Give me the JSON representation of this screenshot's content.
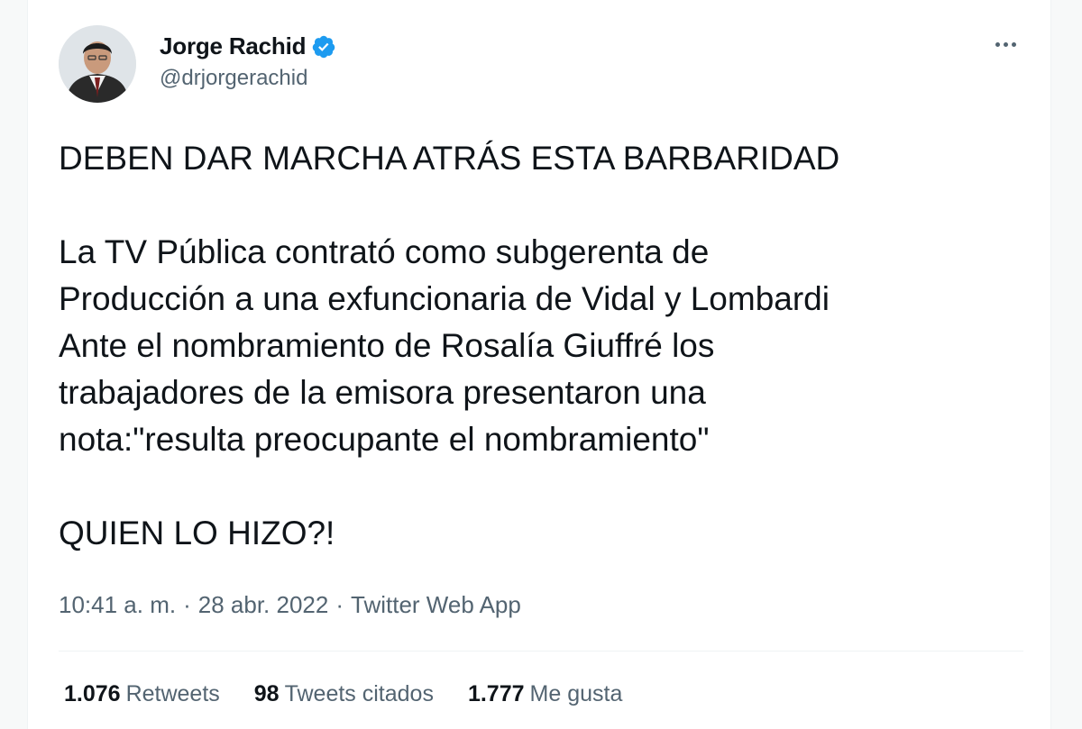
{
  "author": {
    "name": "Jorge Rachid",
    "handle": "@drjorgerachid",
    "verified": true,
    "avatar_icon": "profile-photo"
  },
  "tweet": {
    "lines": [
      "DEBEN DAR MARCHA ATRÁS ESTA BARBARIDAD",
      "",
      "La TV Pública contrató como subgerenta de",
      "Producción a una exfuncionaria de Vidal y Lombardi",
      "Ante el nombramiento de Rosalía Giuffré los",
      "trabajadores de la emisora presentaron una",
      "nota:\"resulta preocupante el nombramiento\"",
      "",
      "QUIEN LO HIZO?!"
    ]
  },
  "meta": {
    "time": "10:41 a. m.",
    "separator1": "·",
    "date": "28 abr. 2022",
    "separator2": "·",
    "source": "Twitter Web App"
  },
  "stats": {
    "retweets_count": "1.076",
    "retweets_label": "Retweets",
    "quotes_count": "98",
    "quotes_label": "Tweets citados",
    "likes_count": "1.777",
    "likes_label": "Me gusta"
  },
  "colors": {
    "text": "#0f1419",
    "secondary": "#536471",
    "verified": "#1d9bf0",
    "divider": "#eff3f4"
  }
}
